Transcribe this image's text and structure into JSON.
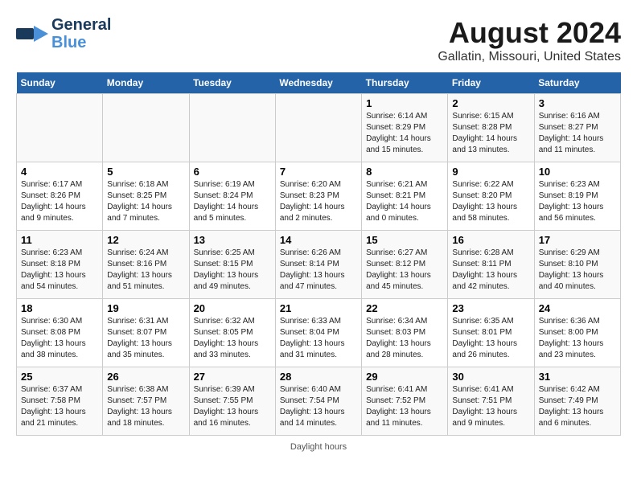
{
  "header": {
    "logo_line1": "General",
    "logo_line2": "Blue",
    "title": "August 2024",
    "subtitle": "Gallatin, Missouri, United States"
  },
  "days": [
    "Sunday",
    "Monday",
    "Tuesday",
    "Wednesday",
    "Thursday",
    "Friday",
    "Saturday"
  ],
  "footer": "Daylight hours",
  "weeks": [
    [
      {
        "date": "",
        "info": ""
      },
      {
        "date": "",
        "info": ""
      },
      {
        "date": "",
        "info": ""
      },
      {
        "date": "",
        "info": ""
      },
      {
        "date": "1",
        "info": "Sunrise: 6:14 AM\nSunset: 8:29 PM\nDaylight: 14 hours and 15 minutes."
      },
      {
        "date": "2",
        "info": "Sunrise: 6:15 AM\nSunset: 8:28 PM\nDaylight: 14 hours and 13 minutes."
      },
      {
        "date": "3",
        "info": "Sunrise: 6:16 AM\nSunset: 8:27 PM\nDaylight: 14 hours and 11 minutes."
      }
    ],
    [
      {
        "date": "4",
        "info": "Sunrise: 6:17 AM\nSunset: 8:26 PM\nDaylight: 14 hours and 9 minutes."
      },
      {
        "date": "5",
        "info": "Sunrise: 6:18 AM\nSunset: 8:25 PM\nDaylight: 14 hours and 7 minutes."
      },
      {
        "date": "6",
        "info": "Sunrise: 6:19 AM\nSunset: 8:24 PM\nDaylight: 14 hours and 5 minutes."
      },
      {
        "date": "7",
        "info": "Sunrise: 6:20 AM\nSunset: 8:23 PM\nDaylight: 14 hours and 2 minutes."
      },
      {
        "date": "8",
        "info": "Sunrise: 6:21 AM\nSunset: 8:21 PM\nDaylight: 14 hours and 0 minutes."
      },
      {
        "date": "9",
        "info": "Sunrise: 6:22 AM\nSunset: 8:20 PM\nDaylight: 13 hours and 58 minutes."
      },
      {
        "date": "10",
        "info": "Sunrise: 6:23 AM\nSunset: 8:19 PM\nDaylight: 13 hours and 56 minutes."
      }
    ],
    [
      {
        "date": "11",
        "info": "Sunrise: 6:23 AM\nSunset: 8:18 PM\nDaylight: 13 hours and 54 minutes."
      },
      {
        "date": "12",
        "info": "Sunrise: 6:24 AM\nSunset: 8:16 PM\nDaylight: 13 hours and 51 minutes."
      },
      {
        "date": "13",
        "info": "Sunrise: 6:25 AM\nSunset: 8:15 PM\nDaylight: 13 hours and 49 minutes."
      },
      {
        "date": "14",
        "info": "Sunrise: 6:26 AM\nSunset: 8:14 PM\nDaylight: 13 hours and 47 minutes."
      },
      {
        "date": "15",
        "info": "Sunrise: 6:27 AM\nSunset: 8:12 PM\nDaylight: 13 hours and 45 minutes."
      },
      {
        "date": "16",
        "info": "Sunrise: 6:28 AM\nSunset: 8:11 PM\nDaylight: 13 hours and 42 minutes."
      },
      {
        "date": "17",
        "info": "Sunrise: 6:29 AM\nSunset: 8:10 PM\nDaylight: 13 hours and 40 minutes."
      }
    ],
    [
      {
        "date": "18",
        "info": "Sunrise: 6:30 AM\nSunset: 8:08 PM\nDaylight: 13 hours and 38 minutes."
      },
      {
        "date": "19",
        "info": "Sunrise: 6:31 AM\nSunset: 8:07 PM\nDaylight: 13 hours and 35 minutes."
      },
      {
        "date": "20",
        "info": "Sunrise: 6:32 AM\nSunset: 8:05 PM\nDaylight: 13 hours and 33 minutes."
      },
      {
        "date": "21",
        "info": "Sunrise: 6:33 AM\nSunset: 8:04 PM\nDaylight: 13 hours and 31 minutes."
      },
      {
        "date": "22",
        "info": "Sunrise: 6:34 AM\nSunset: 8:03 PM\nDaylight: 13 hours and 28 minutes."
      },
      {
        "date": "23",
        "info": "Sunrise: 6:35 AM\nSunset: 8:01 PM\nDaylight: 13 hours and 26 minutes."
      },
      {
        "date": "24",
        "info": "Sunrise: 6:36 AM\nSunset: 8:00 PM\nDaylight: 13 hours and 23 minutes."
      }
    ],
    [
      {
        "date": "25",
        "info": "Sunrise: 6:37 AM\nSunset: 7:58 PM\nDaylight: 13 hours and 21 minutes."
      },
      {
        "date": "26",
        "info": "Sunrise: 6:38 AM\nSunset: 7:57 PM\nDaylight: 13 hours and 18 minutes."
      },
      {
        "date": "27",
        "info": "Sunrise: 6:39 AM\nSunset: 7:55 PM\nDaylight: 13 hours and 16 minutes."
      },
      {
        "date": "28",
        "info": "Sunrise: 6:40 AM\nSunset: 7:54 PM\nDaylight: 13 hours and 14 minutes."
      },
      {
        "date": "29",
        "info": "Sunrise: 6:41 AM\nSunset: 7:52 PM\nDaylight: 13 hours and 11 minutes."
      },
      {
        "date": "30",
        "info": "Sunrise: 6:41 AM\nSunset: 7:51 PM\nDaylight: 13 hours and 9 minutes."
      },
      {
        "date": "31",
        "info": "Sunrise: 6:42 AM\nSunset: 7:49 PM\nDaylight: 13 hours and 6 minutes."
      }
    ]
  ]
}
